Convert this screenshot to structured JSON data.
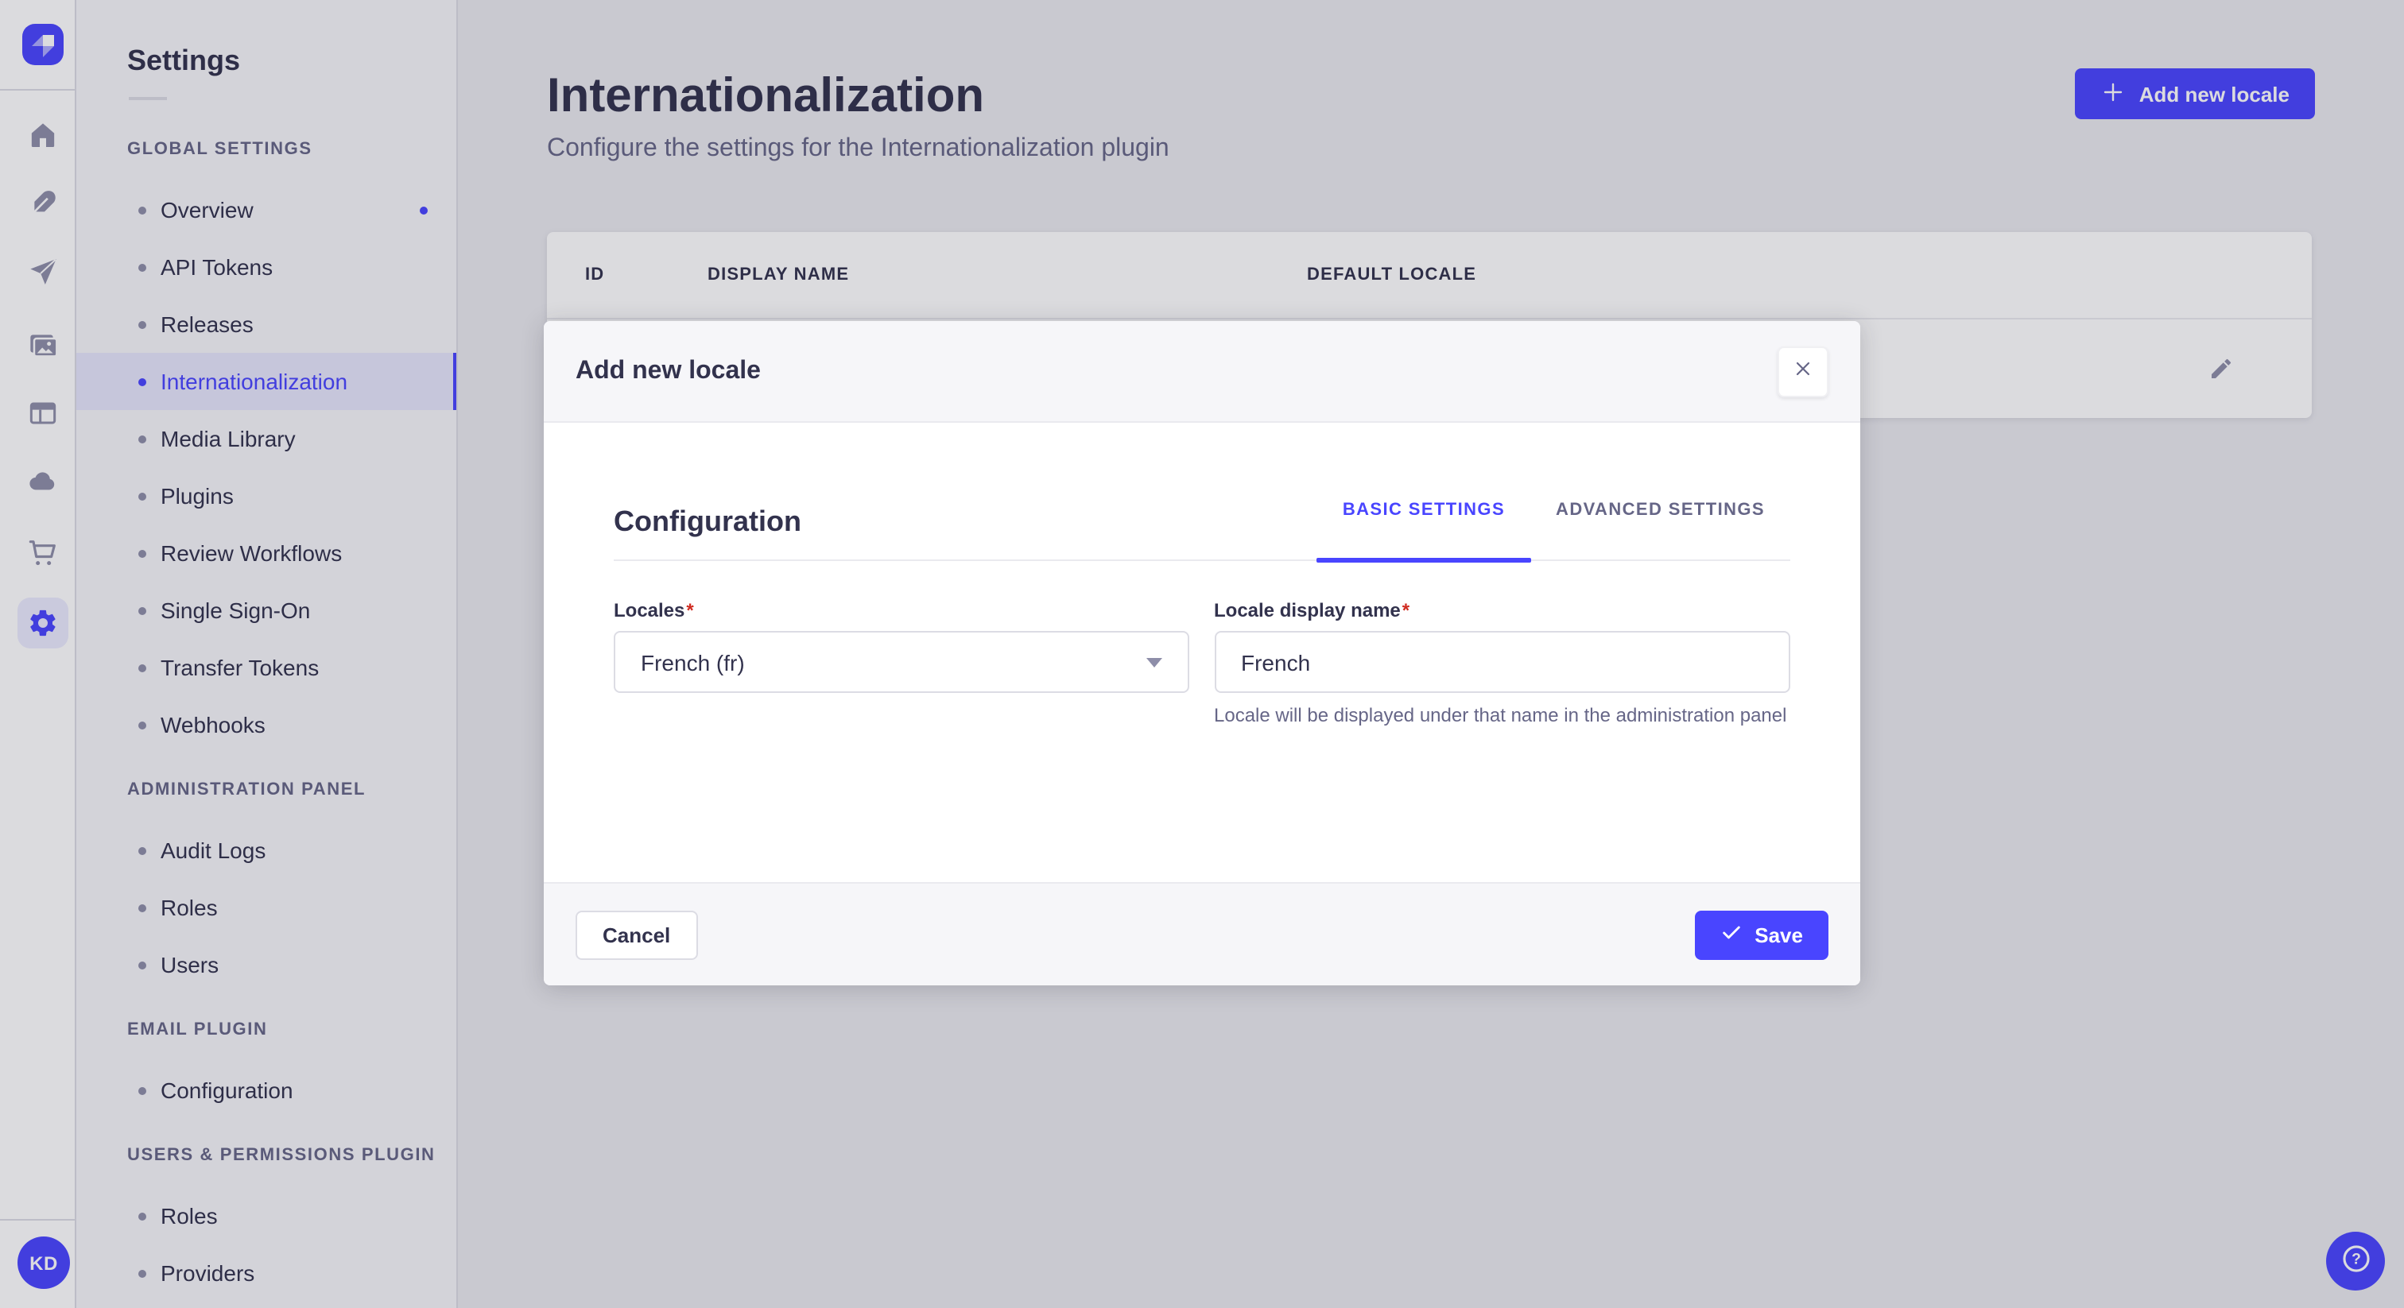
{
  "colors": {
    "accent": "#4945ff",
    "text_dark": "#32324d",
    "text_muted": "#666687"
  },
  "rail": {
    "avatar_initials": "KD"
  },
  "subnav": {
    "title": "Settings",
    "sections": [
      {
        "label": "GLOBAL SETTINGS",
        "items": [
          {
            "label": "Overview"
          },
          {
            "label": "API Tokens"
          },
          {
            "label": "Releases"
          },
          {
            "label": "Internationalization"
          },
          {
            "label": "Media Library"
          },
          {
            "label": "Plugins"
          },
          {
            "label": "Review Workflows"
          },
          {
            "label": "Single Sign-On"
          },
          {
            "label": "Transfer Tokens"
          },
          {
            "label": "Webhooks"
          }
        ]
      },
      {
        "label": "ADMINISTRATION PANEL",
        "items": [
          {
            "label": "Audit Logs"
          },
          {
            "label": "Roles"
          },
          {
            "label": "Users"
          }
        ]
      },
      {
        "label": "EMAIL PLUGIN",
        "items": [
          {
            "label": "Configuration"
          }
        ]
      },
      {
        "label": "USERS & PERMISSIONS PLUGIN",
        "items": [
          {
            "label": "Roles"
          },
          {
            "label": "Providers"
          }
        ]
      }
    ]
  },
  "main": {
    "title": "Internationalization",
    "subtitle": "Configure the settings for the Internationalization plugin",
    "add_button_label": "Add new locale",
    "table": {
      "columns": [
        "ID",
        "DISPLAY NAME",
        "DEFAULT LOCALE"
      ]
    }
  },
  "modal": {
    "title": "Add new locale",
    "section_title": "Configuration",
    "tabs": [
      {
        "label": "BASIC SETTINGS"
      },
      {
        "label": "ADVANCED SETTINGS"
      }
    ],
    "locales_field": {
      "label": "Locales",
      "required": "*",
      "value": "French (fr)"
    },
    "display_name_field": {
      "label": "Locale display name",
      "required": "*",
      "value": "French",
      "helper": "Locale will be displayed under that name in the administration panel"
    },
    "cancel_label": "Cancel",
    "save_label": "Save"
  }
}
